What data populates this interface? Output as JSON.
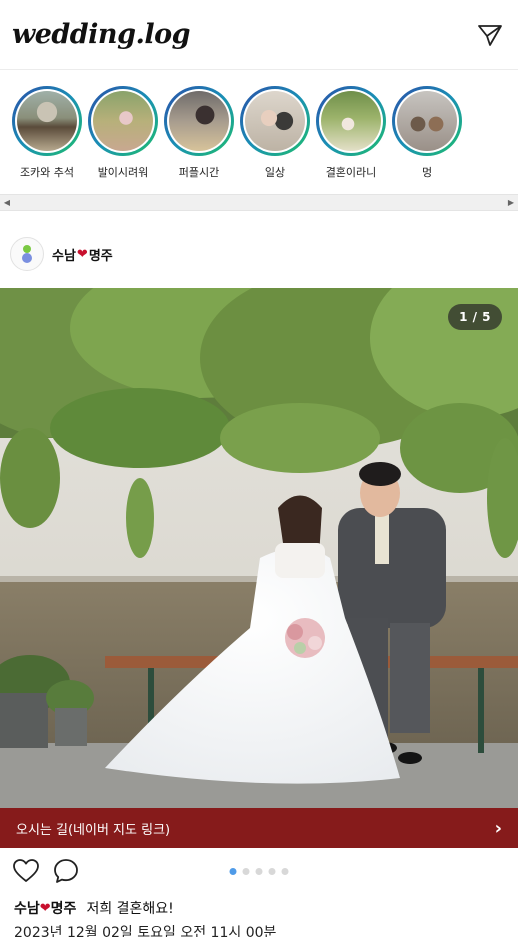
{
  "app": {
    "logo": "wedding.log"
  },
  "stories": [
    {
      "label": "조카와 추석",
      "icon": "story-thumbnail"
    },
    {
      "label": "발이시려워",
      "icon": "story-thumbnail"
    },
    {
      "label": "퍼플시간",
      "icon": "story-thumbnail"
    },
    {
      "label": "일상",
      "icon": "story-thumbnail"
    },
    {
      "label": "결혼이라니",
      "icon": "story-thumbnail"
    },
    {
      "label": "멍",
      "icon": "story-thumbnail"
    }
  ],
  "post": {
    "author_left": "수남",
    "author_heart": "❤",
    "author_right": "명주",
    "counter": "1 / 5",
    "map_link": "오시는 길(네이버 지도 링크)",
    "carousel": {
      "total": 5,
      "active": 1
    },
    "caption": "저희 결혼해요!",
    "date": "2023년 12월 02일 토요일 오전 11시 00분"
  },
  "colors": {
    "accent_bar": "#861b1b",
    "dot_active": "#4f9be8",
    "ring_start": "#2b4ea8",
    "ring_end": "#1fbf6a"
  }
}
